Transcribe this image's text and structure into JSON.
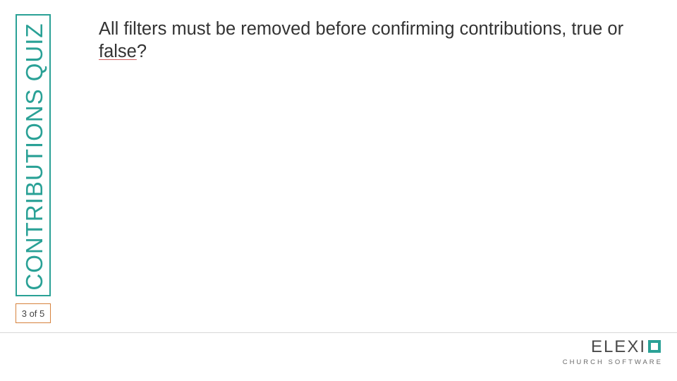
{
  "sidebar": {
    "title": "CONTRIBUTIONS QUIZ",
    "page_counter": "3 of 5"
  },
  "question": {
    "text_part1": "All filters must be removed before confirming contributions, true or ",
    "text_false": "false",
    "text_part2": "?"
  },
  "logo": {
    "letters_before": "ELEXI",
    "subline": "CHURCH SOFTWARE"
  }
}
